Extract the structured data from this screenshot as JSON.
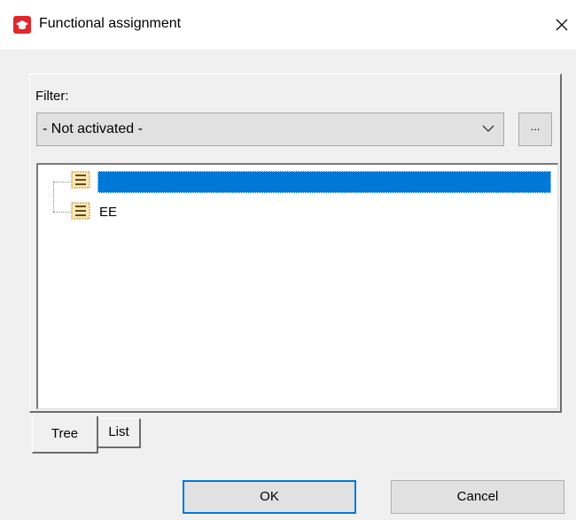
{
  "window": {
    "title": "Functional assignment",
    "icon": "app-logo-icon"
  },
  "filter": {
    "label": "Filter:",
    "selected": "- Not activated -",
    "more_label": "..."
  },
  "tree": {
    "nodes": [
      {
        "label": "",
        "selected": true,
        "icon": "folder-grid-icon"
      },
      {
        "label": "EE",
        "selected": false,
        "icon": "folder-grid-icon"
      }
    ]
  },
  "tabs": [
    {
      "label": "Tree",
      "active": true
    },
    {
      "label": "List",
      "active": false
    }
  ],
  "buttons": {
    "ok": "OK",
    "cancel": "Cancel"
  },
  "colors": {
    "accent": "#0078d7",
    "app_icon": "#e0272c",
    "node_icon": "#fce8b6"
  }
}
